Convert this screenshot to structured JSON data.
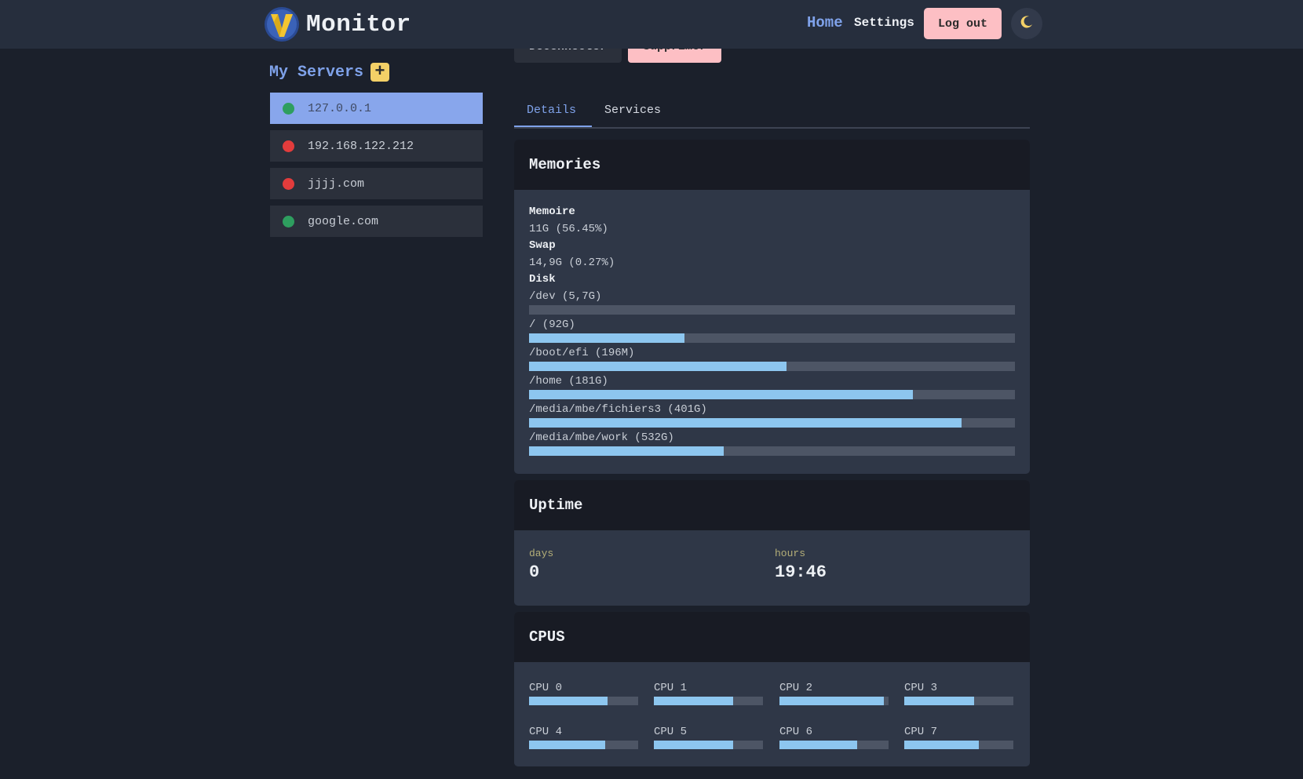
{
  "nav": {
    "brand": "Monitor",
    "home": "Home",
    "settings": "Settings",
    "logout": "Log out",
    "theme_icon": "moon-icon"
  },
  "sidebar": {
    "title": "My Servers",
    "add_label": "+",
    "servers": [
      {
        "label": "127.0.0.1",
        "status": "up",
        "active": true
      },
      {
        "label": "192.168.122.212",
        "status": "down",
        "active": false
      },
      {
        "label": "jjjj.com",
        "status": "down",
        "active": false
      },
      {
        "label": "google.com",
        "status": "up",
        "active": false
      }
    ]
  },
  "actions": {
    "disconnect": "Déconnecter",
    "delete": "Supprimer"
  },
  "tabs": {
    "details": "Details",
    "services": "Services",
    "active": "details"
  },
  "memories": {
    "title": "Memories",
    "memory_label": "Memoire",
    "memory_value": "11G (56.45%)",
    "swap_label": "Swap",
    "swap_value": "14,9G (0.27%)",
    "disk_label": "Disk",
    "disks": [
      {
        "name": "/dev (5,7G)",
        "usage": 0.0
      },
      {
        "name": "/ (92G)",
        "usage": 0.32
      },
      {
        "name": "/boot/efi (196M)",
        "usage": 0.53
      },
      {
        "name": "/home (181G)",
        "usage": 0.79
      },
      {
        "name": "/media/mbe/fichiers3 (401G)",
        "usage": 0.89
      },
      {
        "name": "/media/mbe/work (532G)",
        "usage": 0.4
      }
    ]
  },
  "uptime": {
    "title": "Uptime",
    "days_label": "days",
    "days_value": "0",
    "hours_label": "hours",
    "hours_value": "19:46"
  },
  "cpus": {
    "title": "CPUS",
    "items": [
      {
        "label": "CPU 0",
        "usage": 0.72
      },
      {
        "label": "CPU 1",
        "usage": 0.73
      },
      {
        "label": "CPU 2",
        "usage": 0.96
      },
      {
        "label": "CPU 3",
        "usage": 0.64
      },
      {
        "label": "CPU 4",
        "usage": 0.7
      },
      {
        "label": "CPU 5",
        "usage": 0.73
      },
      {
        "label": "CPU 6",
        "usage": 0.71
      },
      {
        "label": "CPU 7",
        "usage": 0.68
      }
    ]
  },
  "colors": {
    "accent": "#7fa2ea",
    "status_up": "#2e9e5f",
    "status_down": "#e23c3c",
    "bar_fill": "#8dc6ef",
    "danger_button": "#fdbfc4",
    "add_button": "#f3d067"
  }
}
